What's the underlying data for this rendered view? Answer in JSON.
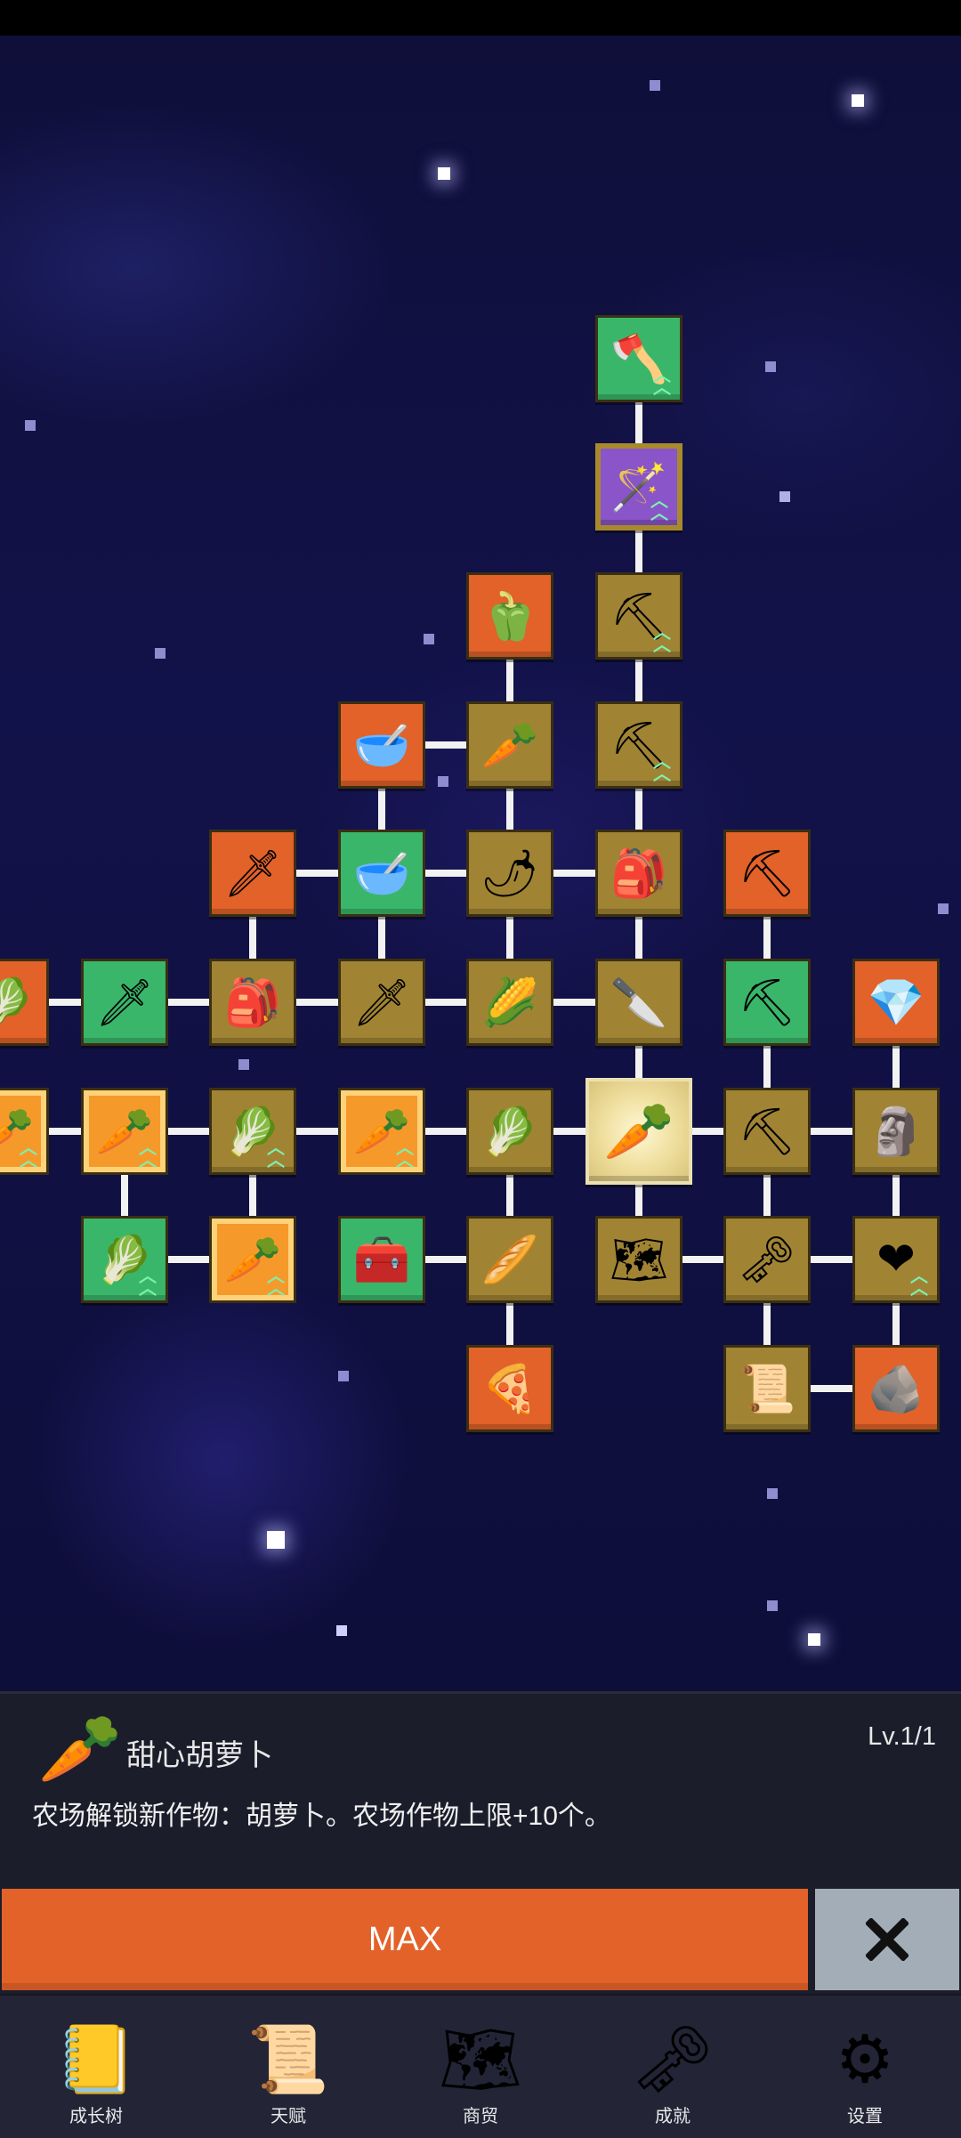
{
  "tree": {
    "nodes": [
      {
        "id": "shovel-top",
        "icon": "🪓",
        "style": "green",
        "chev": true
      },
      {
        "id": "shovel-magic",
        "icon": "🪄",
        "style": "purple",
        "chev": true
      },
      {
        "id": "pepper-green",
        "icon": "🫑",
        "style": "orange",
        "chev": false
      },
      {
        "id": "shovel-3",
        "icon": "⛏",
        "style": "gold",
        "chev": true
      },
      {
        "id": "bowl-1",
        "icon": "🥣",
        "style": "orange",
        "chev": false
      },
      {
        "id": "radish",
        "icon": "🥕",
        "style": "gold",
        "chev": false
      },
      {
        "id": "shovel-4",
        "icon": "⛏",
        "style": "gold",
        "chev": true
      },
      {
        "id": "sword-gold",
        "icon": "🗡",
        "style": "orange",
        "chev": false
      },
      {
        "id": "bowl-2",
        "icon": "🥣",
        "style": "green",
        "chev": false
      },
      {
        "id": "chili",
        "icon": "🌶",
        "style": "gold",
        "chev": false
      },
      {
        "id": "backpack-1",
        "icon": "🎒",
        "style": "gold",
        "chev": false
      },
      {
        "id": "pickaxe-gold",
        "icon": "⛏",
        "style": "orange",
        "chev": false
      },
      {
        "id": "partial-left-1",
        "icon": "🥬",
        "style": "orange",
        "chev": false
      },
      {
        "id": "sword-2",
        "icon": "🗡",
        "style": "green",
        "chev": false
      },
      {
        "id": "backpack-2",
        "icon": "🎒",
        "style": "gold",
        "chev": false
      },
      {
        "id": "sword-3",
        "icon": "🗡",
        "style": "gold",
        "chev": false
      },
      {
        "id": "corn",
        "icon": "🌽",
        "style": "gold",
        "chev": false
      },
      {
        "id": "knife",
        "icon": "🔪",
        "style": "gold",
        "chev": false
      },
      {
        "id": "pickaxe-2",
        "icon": "⛏",
        "style": "green",
        "chev": false
      },
      {
        "id": "crystal",
        "icon": "💎",
        "style": "orange",
        "chev": false
      },
      {
        "id": "partial-left-2",
        "icon": "🥕",
        "style": "framed",
        "chev": true
      },
      {
        "id": "carrot-1",
        "icon": "🥕",
        "style": "framed",
        "chev": true
      },
      {
        "id": "cabbage-1",
        "icon": "🥬",
        "style": "gold",
        "chev": true
      },
      {
        "id": "carrot-2",
        "icon": "🥕",
        "style": "framed",
        "chev": true
      },
      {
        "id": "cabbage-2",
        "icon": "🥬",
        "style": "gold",
        "chev": false
      },
      {
        "id": "carrot-selected",
        "icon": "🥕",
        "style": "selected",
        "chev": false
      },
      {
        "id": "pickaxe-3",
        "icon": "⛏",
        "style": "gold",
        "chev": false
      },
      {
        "id": "statue",
        "icon": "🗿",
        "style": "gold",
        "chev": false
      },
      {
        "id": "cabbage-3",
        "icon": "🥬",
        "style": "green",
        "chev": true
      },
      {
        "id": "carrot-3",
        "icon": "🥕",
        "style": "framed",
        "chev": true
      },
      {
        "id": "chest",
        "icon": "🧰",
        "style": "green",
        "chev": false
      },
      {
        "id": "parsnip",
        "icon": "🥖",
        "style": "gold",
        "chev": false
      },
      {
        "id": "map",
        "icon": "🗺",
        "style": "gold",
        "chev": false
      },
      {
        "id": "key-gold",
        "icon": "🗝",
        "style": "gold",
        "chev": false
      },
      {
        "id": "heart",
        "icon": "❤",
        "style": "gold",
        "chev": true
      },
      {
        "id": "pizza",
        "icon": "🍕",
        "style": "orange",
        "chev": false
      },
      {
        "id": "scroll",
        "icon": "📜",
        "style": "gold",
        "chev": false
      },
      {
        "id": "stone",
        "icon": "🪨",
        "style": "orange",
        "chev": false
      }
    ]
  },
  "info": {
    "icon": "🥕",
    "title": "甜心胡萝卜",
    "level": "Lv.1/1",
    "description": "农场解锁新作物：胡萝卜。农场作物上限+10个。"
  },
  "actions": {
    "max_label": "MAX",
    "close_icon": "close-icon"
  },
  "nav": {
    "items": [
      {
        "icon": "📒",
        "label": "成长树"
      },
      {
        "icon": "📜",
        "label": "天赋"
      },
      {
        "icon": "🗺",
        "label": "商贸"
      },
      {
        "icon": "🗝",
        "label": "成就"
      },
      {
        "icon": "⚙",
        "label": "设置"
      }
    ]
  },
  "colors": {
    "accent_orange": "#e3622a",
    "node_gold": "#a08434",
    "node_green": "#3ab66a",
    "node_purple": "#8a55c8",
    "panel_bg": "#1c1d2b",
    "nav_bg": "#232436"
  }
}
